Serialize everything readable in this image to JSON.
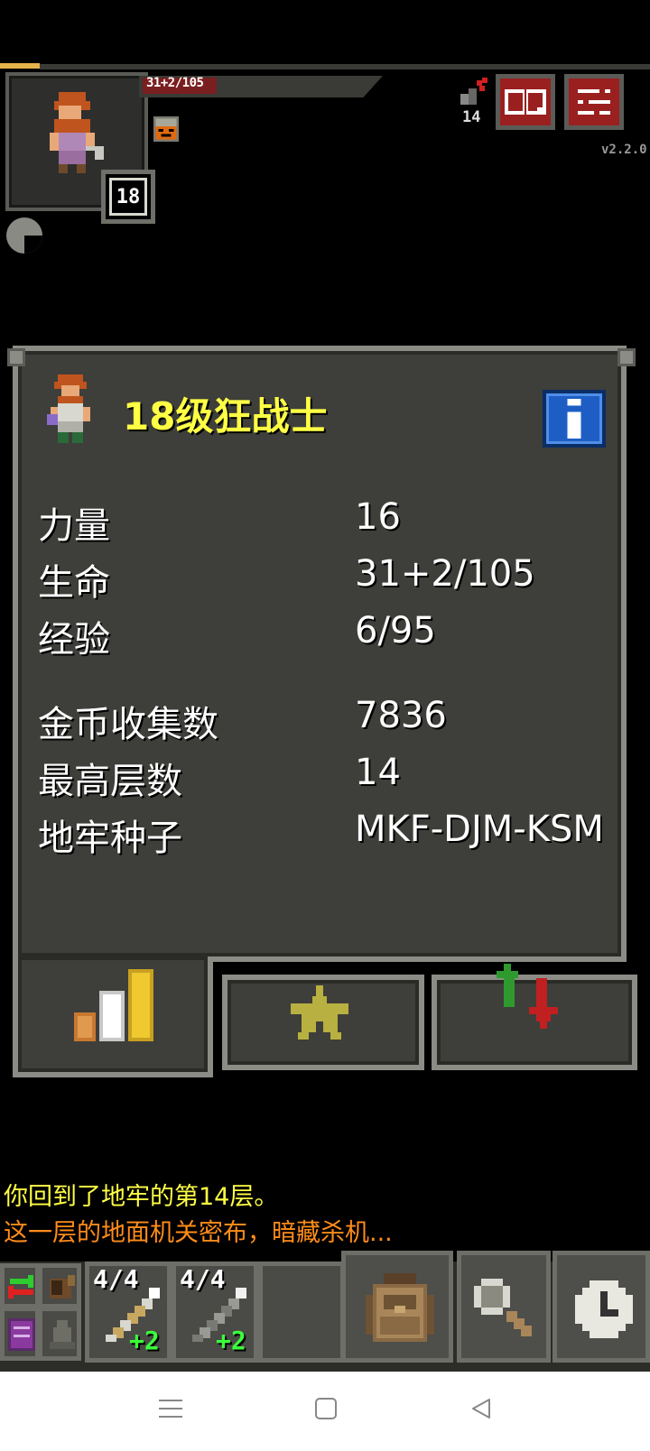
{
  "hud": {
    "hp_text": "31+2/105",
    "hp_fraction": 0.3,
    "xp_fraction": 0.06,
    "level": "18",
    "depth": "14",
    "version": "v2.2.0",
    "icons": {
      "journal": "journal-icon",
      "menu": "menu-icon",
      "buff": "berserk-buff-icon",
      "depth": "depth-stairs-icon",
      "busy": "busy-pie-icon"
    },
    "colors": {
      "hp": "#7a1f1f",
      "xp": "#e6b24a",
      "hud_button": "#9a2020"
    }
  },
  "stats_window": {
    "title": "18级狂战士",
    "title_color": "#ffff44",
    "info_icon": "info-icon",
    "stats": [
      {
        "label": "力量",
        "value": "16"
      },
      {
        "label": "生命",
        "value": "31+2/105"
      },
      {
        "label": "经验",
        "value": "6/95"
      },
      {
        "label": "金币收集数",
        "value": "7836"
      },
      {
        "label": "最高层数",
        "value": "14"
      },
      {
        "label": "地牢种子",
        "value": "MKF-DJM-KSM"
      }
    ],
    "tabs": [
      {
        "name": "stats",
        "icon": "stats-bars-icon",
        "active": true
      },
      {
        "name": "badges",
        "icon": "star-icon",
        "active": false
      },
      {
        "name": "scores",
        "icon": "up-down-arrows-icon",
        "active": false
      }
    ]
  },
  "log": {
    "lines": [
      {
        "text": "你回到了地牢的第14层。",
        "color": "#ffff44"
      },
      {
        "text": "这一层的地面机关密布，暗藏杀机...",
        "color": "#ff8c1a"
      }
    ]
  },
  "toolbar": {
    "quickslots": [
      {
        "icon": "wand-icon",
        "count": "4/4",
        "bonus": "+2"
      },
      {
        "icon": "wand-icon",
        "count": "4/4",
        "bonus": "+2"
      }
    ],
    "buttons": {
      "swap": "swap-icon",
      "bag": "backpack-icon",
      "search": "magnifier-icon",
      "wait": "clock-icon"
    }
  },
  "nav": {
    "icons": [
      "menu-lines-icon",
      "home-square-icon",
      "back-triangle-icon"
    ]
  }
}
